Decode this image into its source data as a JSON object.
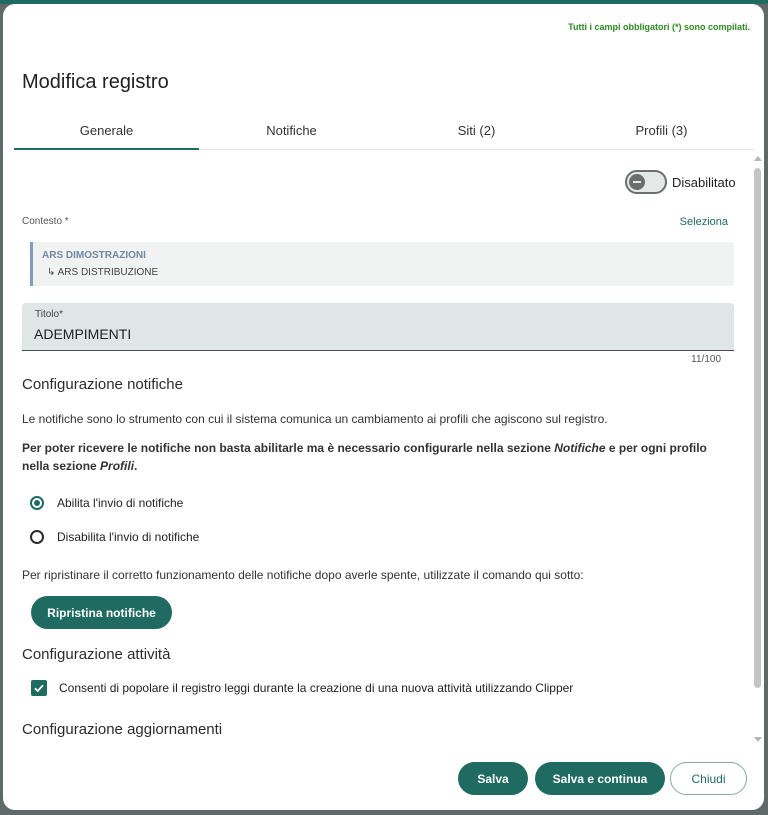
{
  "dialog": {
    "required_note": "Tutti i campi obbligatori (*) sono compilati.",
    "title": "Modifica registro"
  },
  "tabs": [
    {
      "label": "Generale",
      "active": true
    },
    {
      "label": "Notifiche",
      "active": false
    },
    {
      "label": "Siti (2)",
      "active": false
    },
    {
      "label": "Profili (3)",
      "active": false
    }
  ],
  "status_toggle": {
    "label": "Disabilitato",
    "enabled": false
  },
  "context": {
    "label": "Contesto *",
    "select_link": "Seleziona",
    "main": "ARS DIMOSTRAZIONI",
    "sub": "↳ ARS DISTRIBUZIONE"
  },
  "title_field": {
    "label": "Titolo*",
    "value": "ADEMPIMENTI",
    "counter": "11/100"
  },
  "notifications": {
    "heading": "Configurazione notifiche",
    "description": "Le notifiche sono lo strumento con cui il sistema comunica un cambiamento ai profili che agiscono sul registro.",
    "warning_part1": "Per poter ricevere le notifiche non basta abilitarle ma è necessario configurarle nella sezione ",
    "warning_em1": "Notifiche",
    "warning_part2": " e per ogni profilo nella sezione ",
    "warning_em2": "Profili",
    "warning_part3": ".",
    "options": [
      {
        "label": "Abilita l'invio di notifiche",
        "checked": true
      },
      {
        "label": "Disabilita l'invio di notifiche",
        "checked": false
      }
    ],
    "reset_hint": "Per ripristinare il corretto funzionamento delle notifiche dopo averle spente, utilizzate il comando qui sotto:",
    "reset_button": "Ripristina notifiche"
  },
  "activities": {
    "heading": "Configurazione attività",
    "clipper_checkbox": {
      "label": "Consenti di popolare il registro leggi durante la creazione di una nuova attività utilizzando Clipper",
      "checked": true
    }
  },
  "updates": {
    "heading": "Configurazione aggiornamenti"
  },
  "footer": {
    "save": "Salva",
    "save_continue": "Salva e continua",
    "close": "Chiudi"
  },
  "colors": {
    "accent": "#1f6b62",
    "required_note": "#2e8b22",
    "context_main": "#7088a3"
  }
}
